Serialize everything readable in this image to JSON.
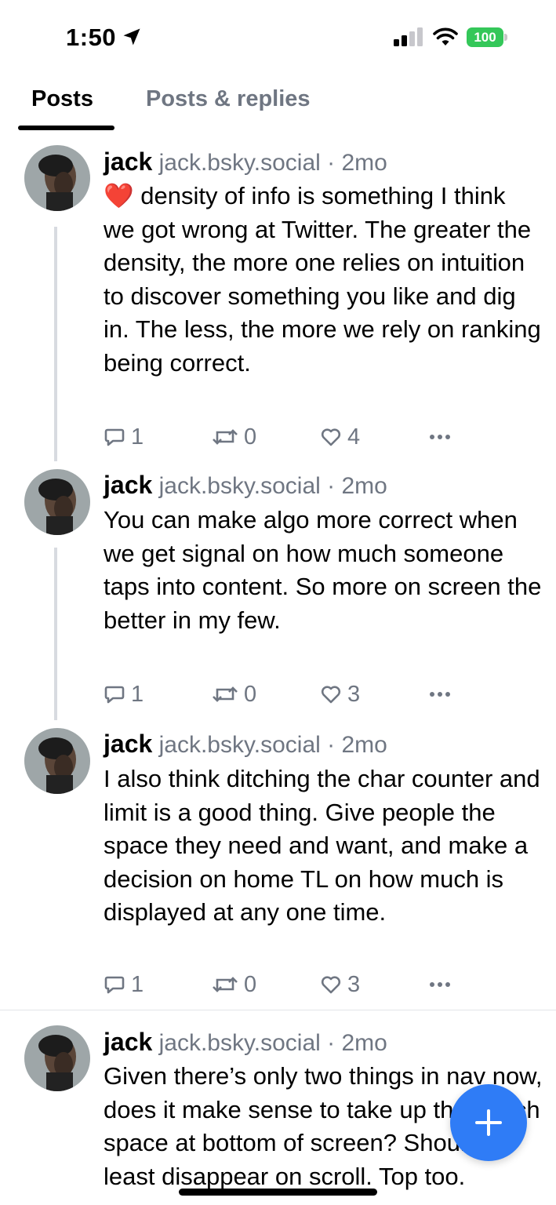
{
  "status_bar": {
    "time": "1:50",
    "battery": "100"
  },
  "tabs": [
    {
      "label": "Posts",
      "active": true
    },
    {
      "label": "Posts & replies",
      "active": false
    }
  ],
  "posts": [
    {
      "author": "jack",
      "handle": "jack.bsky.social · 2mo",
      "emoji": "❤️",
      "text": " density of info is something I think we got wrong at Twitter. The greater the density, the more one relies on intuition to discover something you like and dig in. The less, the more we rely on ranking being correct.",
      "replies": "1",
      "reposts": "0",
      "likes": "4"
    },
    {
      "author": "jack",
      "handle": "jack.bsky.social · 2mo",
      "text": "You can make algo more correct when we get signal on how much someone taps into content. So more on screen the better in my few.",
      "replies": "1",
      "reposts": "0",
      "likes": "3"
    },
    {
      "author": "jack",
      "handle": "jack.bsky.social · 2mo",
      "text": "I also think ditching the char counter and limit is a good thing. Give people the space they need and want, and make a decision on home TL on how much is displayed at any one time.",
      "replies": "1",
      "reposts": "0",
      "likes": "3"
    },
    {
      "author": "jack",
      "handle": "jack.bsky.social · 2mo",
      "text": "Given there’s only two things in nav now, does it make sense to take up that much space at bottom of screen? Should at least disappear on scroll. Top too."
    }
  ],
  "colors": {
    "accent": "#2f7cf6",
    "muted": "#6f7682",
    "battery": "#34c759"
  },
  "icons": [
    "location-arrow-icon",
    "signal-icon",
    "wifi-icon",
    "reply-icon",
    "repost-icon",
    "like-icon",
    "more-icon",
    "plus-icon"
  ]
}
